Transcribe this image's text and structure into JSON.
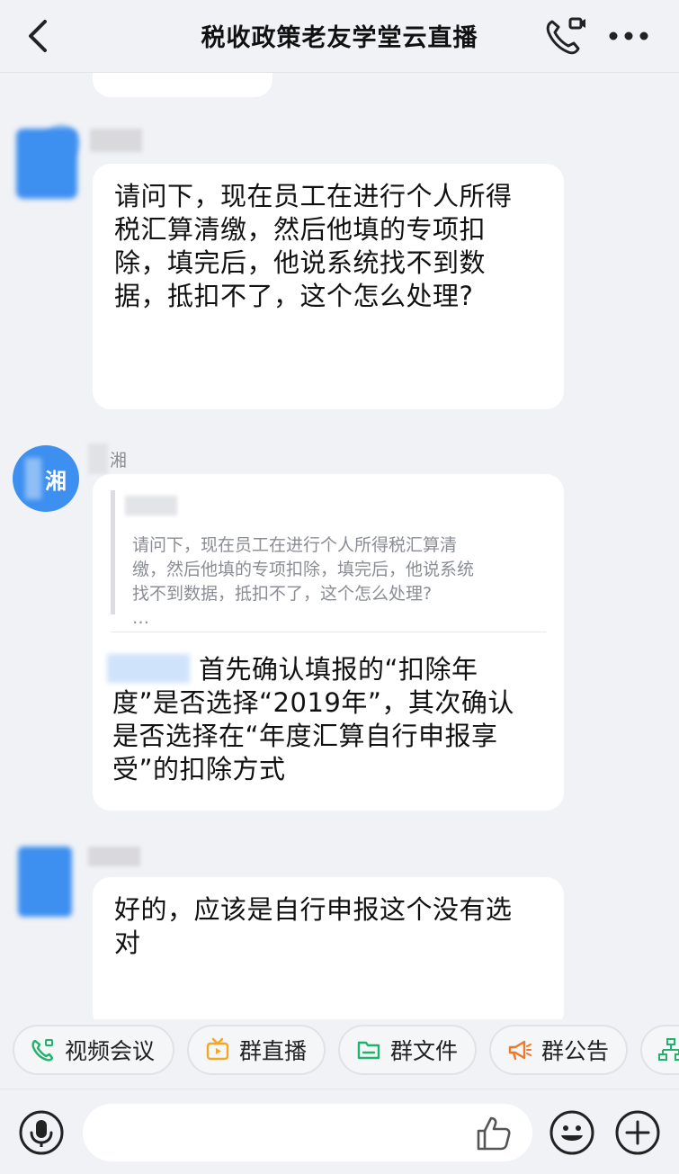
{
  "header": {
    "title": "税收政策老友学堂云直播"
  },
  "messages": [
    {
      "text": "请问下，现在员工在进行个人所得\n税汇算清缴，然后他填的专项扣\n除，填完后，他说系统找不到数\n据，抵扣不了，这个怎么处理?"
    },
    {
      "sender_name": "湘",
      "avatar_text": "湘",
      "quote_text": "请问下，现在员工在进行个人所得税汇算清\n缴，然后他填的专项扣除，填完后，他说系统\n找不到数据，抵扣不了，这个怎么处理?\n…",
      "reply_text": "首先确认填报的“扣除年\n度”是否选择“2019年”，其次确认\n是否选择在“年度汇算自行申报享\n受”的扣除方式"
    },
    {
      "text": "好的，应该是自行申报这个没有选\n对"
    }
  ],
  "quick_actions": [
    {
      "label": "视频会议",
      "icon": "video-call-icon",
      "color": "#1fb36b"
    },
    {
      "label": "群直播",
      "icon": "live-tv-icon",
      "color": "#f5a623"
    },
    {
      "label": "群文件",
      "icon": "folder-icon",
      "color": "#1fb36b"
    },
    {
      "label": "群公告",
      "icon": "megaphone-icon",
      "color": "#f0782a"
    }
  ],
  "input": {
    "placeholder": ""
  },
  "colors": {
    "background": "#f0f2f5",
    "bubble": "#ffffff",
    "avatar_blue": "#3d8ff0"
  }
}
